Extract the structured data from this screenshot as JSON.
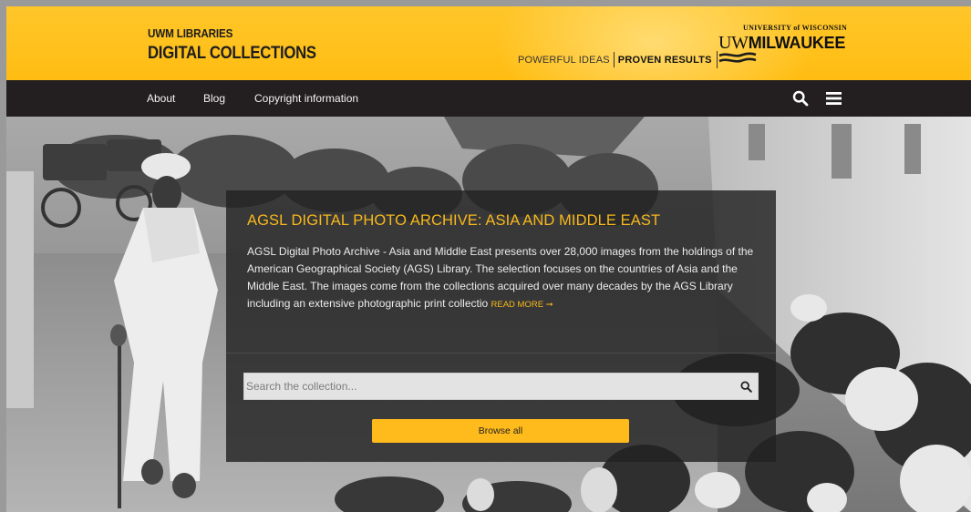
{
  "header": {
    "brand_top": "UWM LIBRARIES",
    "brand_main": "DIGITAL COLLECTIONS",
    "tagline_left": "POWERFUL IDEAS",
    "tagline_right": "PROVEN RESULTS",
    "logo_university": "UNIVERSITY of WISCONSIN",
    "logo_uw": "UW",
    "logo_milwaukee": "MILWAUKEE",
    "bg_color": "#ffc10e"
  },
  "nav": {
    "links": [
      {
        "label": "About"
      },
      {
        "label": "Blog"
      },
      {
        "label": "Copyright information"
      }
    ],
    "icons": [
      "search-icon",
      "menu-icon"
    ],
    "bg_color": "#231f20"
  },
  "hero": {
    "image": "black-and-white street scene with man walking stick and goats",
    "title": "AGSL DIGITAL PHOTO ARCHIVE: ASIA AND MIDDLE EAST",
    "description": "AGSL Digital Photo Archive - Asia and Middle East presents over 28,000 images from the holdings of the American Geographical Society (AGS) Library. The selection focuses on the countries of Asia and the Middle East. The images come from the collections acquired over many decades by the AGS Library including an extensive photographic print collectio",
    "read_more": "READ MORE ➞",
    "search_placeholder": "Search the collection...",
    "browse_label": "Browse all",
    "accent_color": "#f8b81c"
  }
}
